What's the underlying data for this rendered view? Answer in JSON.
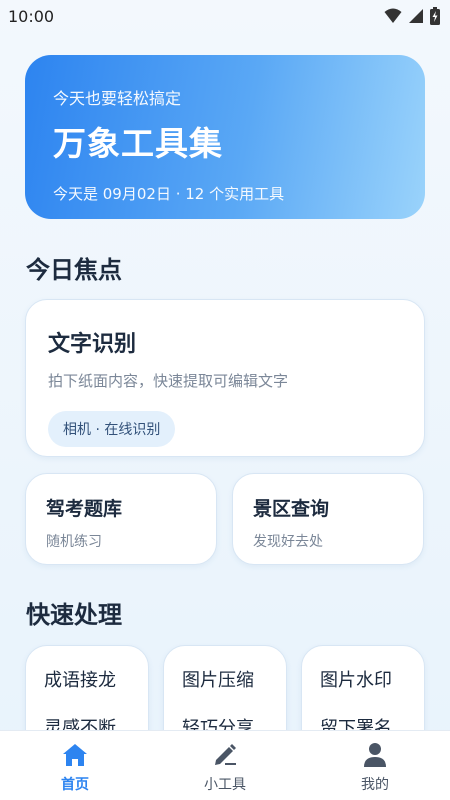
{
  "status": {
    "time": "10:00"
  },
  "hero": {
    "subtitle": "今天也要轻松搞定",
    "title": "万象工具集",
    "meta": "今天是 09月02日 · 12 个实用工具"
  },
  "sections": {
    "focus_title": "今日焦点",
    "quick_title": "快速处理"
  },
  "feature": {
    "title": "文字识别",
    "desc": "拍下纸面内容，快速提取可编辑文字",
    "tag": "相机 · 在线识别"
  },
  "small_cards": [
    {
      "title": "驾考题库",
      "desc": "随机练习"
    },
    {
      "title": "景区查询",
      "desc": "发现好去处"
    }
  ],
  "tools": [
    {
      "name": "成语接龙",
      "sub": "灵感不断"
    },
    {
      "name": "图片压缩",
      "sub": "轻巧分享"
    },
    {
      "name": "图片水印",
      "sub": "留下署名"
    }
  ],
  "nav": [
    {
      "label": "首页",
      "icon": "home-icon",
      "active": true
    },
    {
      "label": "小工具",
      "icon": "pencil-icon",
      "active": false
    },
    {
      "label": "我的",
      "icon": "person-icon",
      "active": false
    }
  ],
  "colors": {
    "accent": "#2d84f0",
    "hero_start": "#2d84f0",
    "hero_end": "#9ad3fb"
  }
}
